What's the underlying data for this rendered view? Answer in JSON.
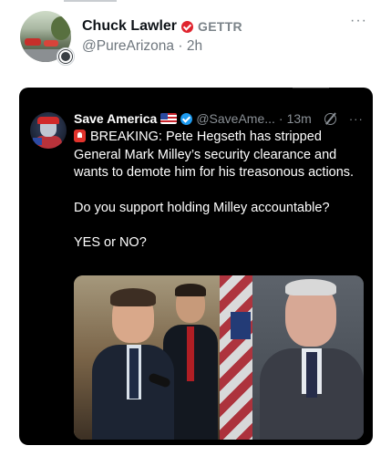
{
  "post": {
    "author_name": "Chuck Lawler",
    "app_label": "GETTR",
    "handle": "@PureArizona",
    "separator": "·",
    "age": "2h",
    "more_label": "···"
  },
  "quoted": {
    "author_name": "Save America",
    "handle": "@SaveAme...",
    "separator": "·",
    "age": "13m",
    "more_label": "···",
    "text_line1": "BREAKING: Pete Hegseth has stripped General Mark Milley’s security clearance and wants to demote him for his treasonous actions.",
    "text_line2": "Do you support holding Milley accountable?",
    "text_line3": "YES or NO?"
  },
  "colors": {
    "verified_red": "#e0242e",
    "verified_blue": "#1d9bf0",
    "card_background": "#000000"
  },
  "icons": [
    "red-verified-icon",
    "more-icon",
    "us-flag-icon",
    "blue-verified-icon",
    "grok-icon",
    "siren-icon"
  ]
}
